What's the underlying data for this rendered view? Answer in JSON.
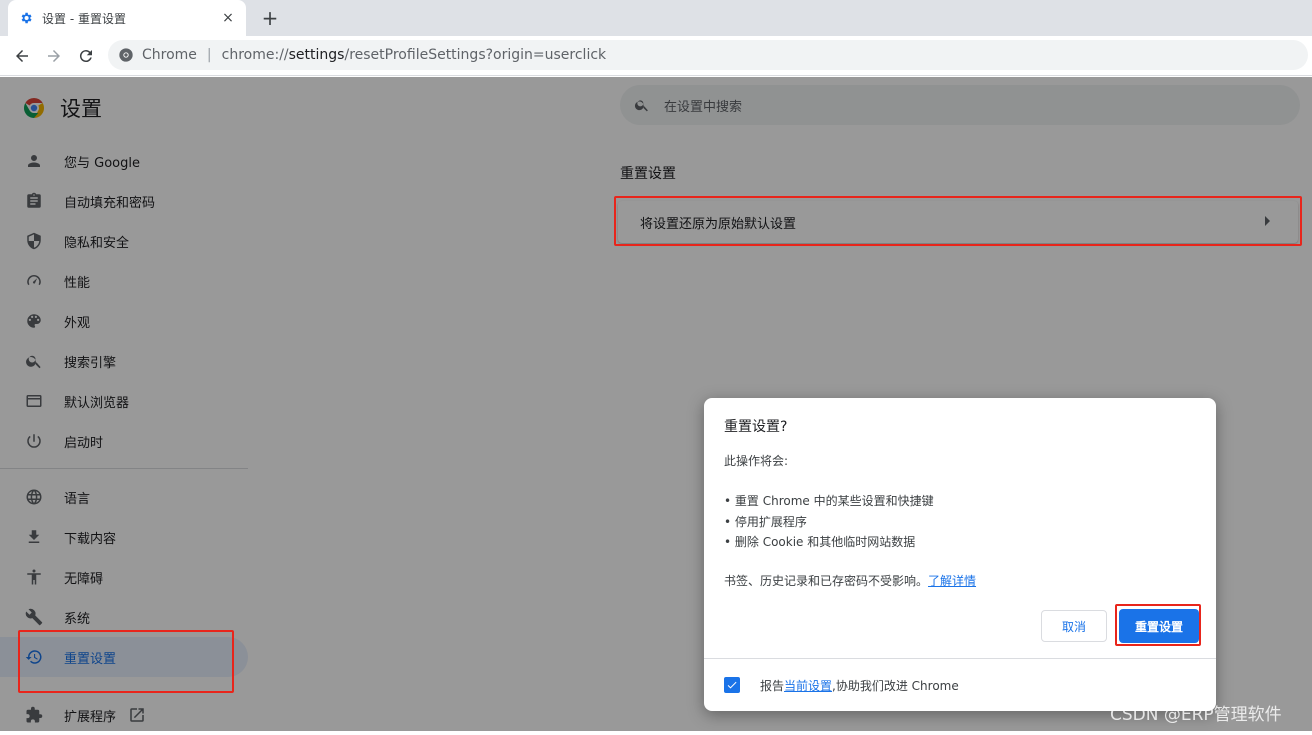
{
  "tab": {
    "title": "设置 - 重置设置",
    "close": "×",
    "new_tab": "+"
  },
  "omnibox": {
    "site": "Chrome",
    "separator": "|",
    "scheme": "chrome://",
    "host": "settings",
    "path": "/resetProfileSettings?origin=userclick"
  },
  "brand": {
    "title": "设置"
  },
  "sidebar": {
    "items": [
      {
        "label": "您与 Google",
        "icon": "person-icon"
      },
      {
        "label": "自动填充和密码",
        "icon": "clipboard-icon"
      },
      {
        "label": "隐私和安全",
        "icon": "shield-icon"
      },
      {
        "label": "性能",
        "icon": "speedometer-icon"
      },
      {
        "label": "外观",
        "icon": "palette-icon"
      },
      {
        "label": "搜索引擎",
        "icon": "search-icon"
      },
      {
        "label": "默认浏览器",
        "icon": "browser-icon"
      },
      {
        "label": "启动时",
        "icon": "power-icon"
      },
      {
        "label": "语言",
        "icon": "globe-icon"
      },
      {
        "label": "下载内容",
        "icon": "download-icon"
      },
      {
        "label": "无障碍",
        "icon": "accessibility-icon"
      },
      {
        "label": "系统",
        "icon": "wrench-icon"
      },
      {
        "label": "重置设置",
        "icon": "history-icon"
      },
      {
        "label": "扩展程序",
        "icon": "puzzle-icon"
      }
    ],
    "active_index": 12
  },
  "search": {
    "placeholder": "在设置中搜索"
  },
  "section": {
    "title": "重置设置",
    "row_label": "将设置还原为原始默认设置"
  },
  "dialog": {
    "title": "重置设置?",
    "intro": "此操作将会:",
    "bullets": [
      "• 重置 Chrome 中的某些设置和快捷键",
      "• 停用扩展程序",
      "• 删除 Cookie 和其他临时网站数据"
    ],
    "note": "书签、历史记录和已存密码不受影响。",
    "learn_more": "了解详情",
    "cancel": "取消",
    "confirm": "重置设置",
    "footer_prefix": "报告",
    "footer_link": "当前设置",
    "footer_suffix": ",协助我们改进 Chrome",
    "report_checked": true
  },
  "watermark": "CSDN @ERP管理软件",
  "colors": {
    "accent": "#1a73e8",
    "highlight": "#e8251b"
  }
}
